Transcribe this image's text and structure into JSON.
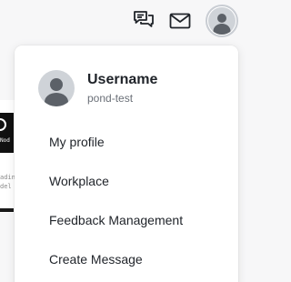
{
  "header": {
    "chat_icon": "chat-bubbles-icon",
    "mail_icon": "mail-icon",
    "avatar_icon": "user-avatar-icon"
  },
  "background": {
    "dark_card_text": "Nod",
    "line_1": "adin",
    "line_2": "del"
  },
  "user_menu": {
    "name": "Username",
    "handle": "pond-test",
    "items": [
      {
        "label": "My profile"
      },
      {
        "label": "Workplace"
      },
      {
        "label": "Feedback Management"
      },
      {
        "label": "Create Message"
      }
    ]
  },
  "colors": {
    "text_primary": "#1f2329",
    "text_secondary": "#6b7078",
    "avatar_bg": "#cfd3d8",
    "avatar_fg": "#5c6168",
    "dropdown_bg": "#ffffff",
    "page_bg": "#f7f7f8"
  }
}
